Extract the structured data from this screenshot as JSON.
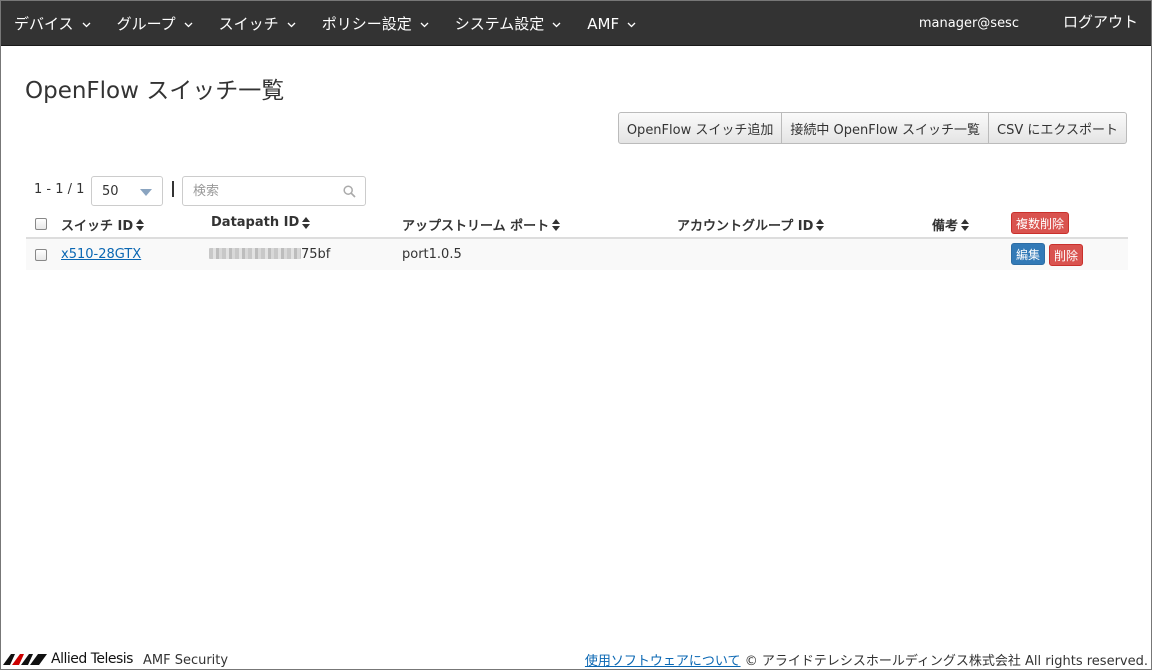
{
  "nav": {
    "items": [
      {
        "label": "デバイス"
      },
      {
        "label": "グループ"
      },
      {
        "label": "スイッチ"
      },
      {
        "label": "ポリシー設定"
      },
      {
        "label": "システム設定"
      },
      {
        "label": "AMF"
      }
    ],
    "user": "manager@sesc",
    "logout": "ログアウト"
  },
  "page": {
    "title": "OpenFlow スイッチ一覧"
  },
  "actions": {
    "add_switch": "OpenFlow スイッチ追加",
    "connected_list": "接続中 OpenFlow スイッチ一覧",
    "csv_export": "CSV にエクスポート"
  },
  "pager": {
    "range": "1 - 1 / 1",
    "page_size": "50"
  },
  "search": {
    "placeholder": "検索",
    "value": ""
  },
  "table": {
    "columns": {
      "switch_id": "スイッチ ID",
      "datapath_id": "Datapath ID",
      "upstream_port": "アップストリーム ポート",
      "account_group_id": "アカウントグループ ID",
      "remarks": "備考"
    },
    "bulk_delete": "複数削除",
    "rows": [
      {
        "switch_id": "x510-28GTX",
        "datapath_id_suffix": "75bf",
        "upstream_port": "port1.0.5",
        "account_group_id": "",
        "remarks": "",
        "edit": "編集",
        "delete": "削除"
      }
    ]
  },
  "footer": {
    "brand": "Allied Telesis",
    "product": "AMF Security",
    "about_link": "使用ソフトウェアについて",
    "copyright": "© アライドテレシスホールディングス株式会社 All rights reserved."
  },
  "colors": {
    "navbar": "#333333",
    "danger": "#d9534f",
    "primary": "#337ab7",
    "link": "#0a67b3"
  }
}
